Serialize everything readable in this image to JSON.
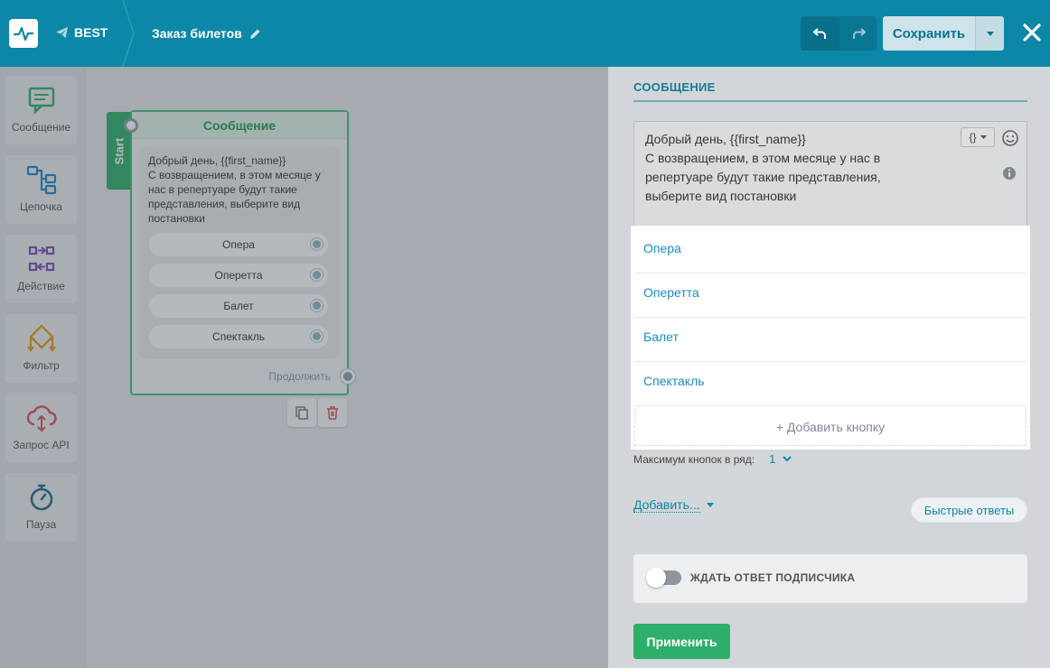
{
  "header": {
    "bot_name": "BEST",
    "flow_title": "Заказ билетов",
    "save_label": "Сохранить"
  },
  "sidebar": {
    "items": [
      {
        "label": "Сообщение",
        "icon": "message-icon"
      },
      {
        "label": "Цепочка",
        "icon": "chain-icon"
      },
      {
        "label": "Действие",
        "icon": "action-icon"
      },
      {
        "label": "Фильтр",
        "icon": "filter-icon"
      },
      {
        "label": "Запрос API",
        "icon": "api-icon"
      },
      {
        "label": "Пауза",
        "icon": "timer-icon"
      }
    ]
  },
  "node": {
    "start_label": "Start",
    "title": "Сообщение",
    "text": "Добрый день,  {{first_name}}\nС возвращением, в этом месяце у нас в репертуаре будут такие представления, выберите вид постановки",
    "buttons": [
      "Опера",
      "Оперетта",
      "Балет",
      "Спектакль"
    ],
    "continue_label": "Продолжить"
  },
  "panel": {
    "section_title": "СООБЩЕНИЕ",
    "message_text": "Добрый день,  {{first_name}}\nС возвращением, в этом месяце у нас в репертуаре будут такие представления, выберите вид постановки",
    "variables_label": "{}",
    "buttons": [
      "Опера",
      "Оперетта",
      "Балет",
      "Спектакль"
    ],
    "add_button_label": "+ Добавить кнопку",
    "max_buttons_label": "Максимум кнопок в ряд:",
    "max_buttons_value": "1",
    "add_label": "Добавить...",
    "quick_replies_label": "Быстрые ответы",
    "wait_reply_label": "ЖДАТЬ ОТВЕТ ПОДПИСЧИКА",
    "wait_reply_enabled": false,
    "apply_label": "Применить"
  },
  "colors": {
    "header": "#0d87a8",
    "accent_green": "#2eaf6b",
    "link_blue": "#1a8bc0"
  }
}
